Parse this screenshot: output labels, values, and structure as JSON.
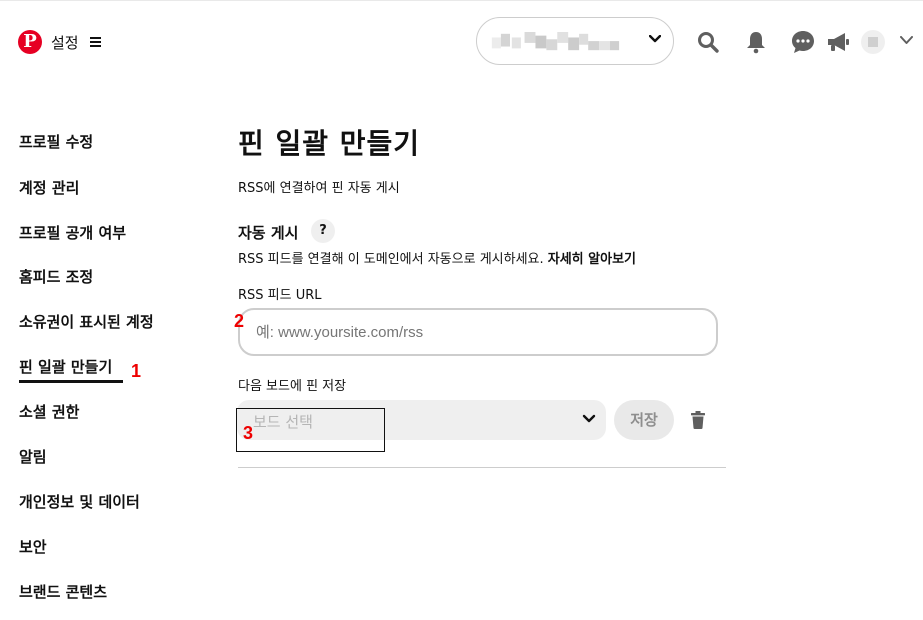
{
  "header": {
    "logo": "P",
    "title": "설정",
    "icons": [
      "pinterest-logo",
      "menu-icon",
      "chevron-down-icon",
      "search-icon",
      "bell-icon",
      "chat-icon",
      "megaphone-icon",
      "avatar",
      "chevron-down-icon"
    ]
  },
  "sidebar": {
    "items": [
      {
        "label": "프로필 수정"
      },
      {
        "label": "계정 관리"
      },
      {
        "label": "프로필 공개 여부"
      },
      {
        "label": "홈피드 조정"
      },
      {
        "label": "소유권이 표시된 계정"
      },
      {
        "label": "핀 일괄 만들기",
        "active": true
      },
      {
        "label": "소셜 권한"
      },
      {
        "label": "알림"
      },
      {
        "label": "개인정보 및 데이터"
      },
      {
        "label": "보안"
      },
      {
        "label": "브랜드 콘텐츠"
      }
    ]
  },
  "main": {
    "title": "핀 일괄 만들기",
    "subtitle": "RSS에 연결하여 핀 자동 게시",
    "section_title": "자동 게시",
    "help_label": "?",
    "description": "RSS 피드를 연결해 이 도메인에서 자동으로 게시하세요.",
    "learn_more": "자세히 알아보기",
    "rss_label": "RSS 피드 URL",
    "rss_placeholder": "예: www.yoursite.com/rss",
    "board_label": "다음 보드에 핀 저장",
    "board_placeholder": "보드 선택",
    "save_label": "저장"
  },
  "annotations": {
    "m1": "1",
    "m2": "2",
    "m3": "3"
  },
  "colors": {
    "brand": "#e60023",
    "marker": "#e00000",
    "field_bg": "#efefef"
  }
}
